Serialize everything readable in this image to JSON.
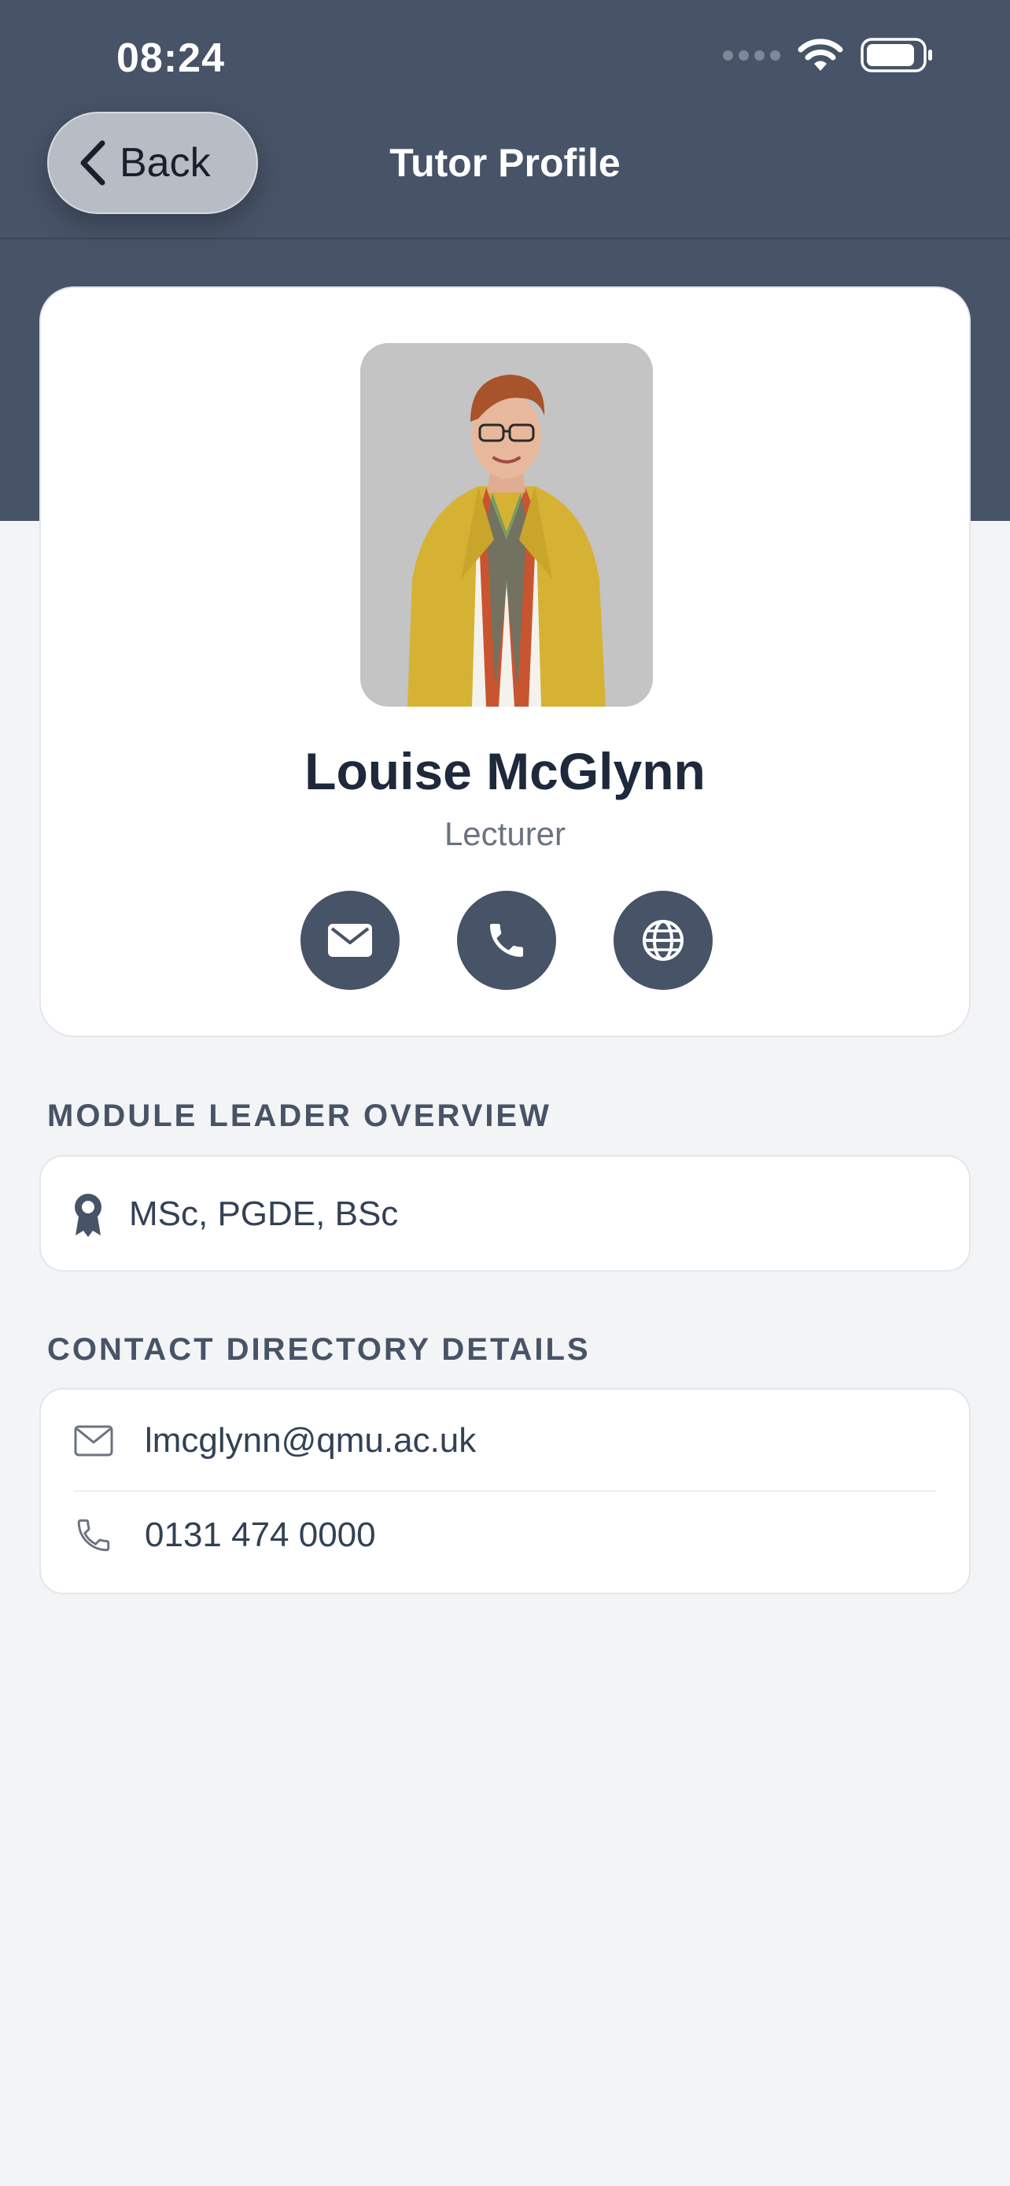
{
  "status_bar": {
    "time": "08:24"
  },
  "nav": {
    "back_label": "Back",
    "title": "Tutor Profile"
  },
  "profile": {
    "name": "Louise McGlynn",
    "role": "Lecturer",
    "actions": [
      "envelope-icon",
      "phone-icon",
      "globe-icon"
    ]
  },
  "overview": {
    "section_title": "MODULE LEADER OVERVIEW",
    "qualifications": "MSc, PGDE, BSc"
  },
  "contact": {
    "section_title": "CONTACT DIRECTORY DETAILS",
    "email": "lmcglynn@qmu.ac.uk",
    "phone": "0131 474 0000"
  },
  "colors": {
    "header": "#475366",
    "background": "#f3f4f6",
    "card": "#ffffff",
    "accent": "#475366"
  }
}
